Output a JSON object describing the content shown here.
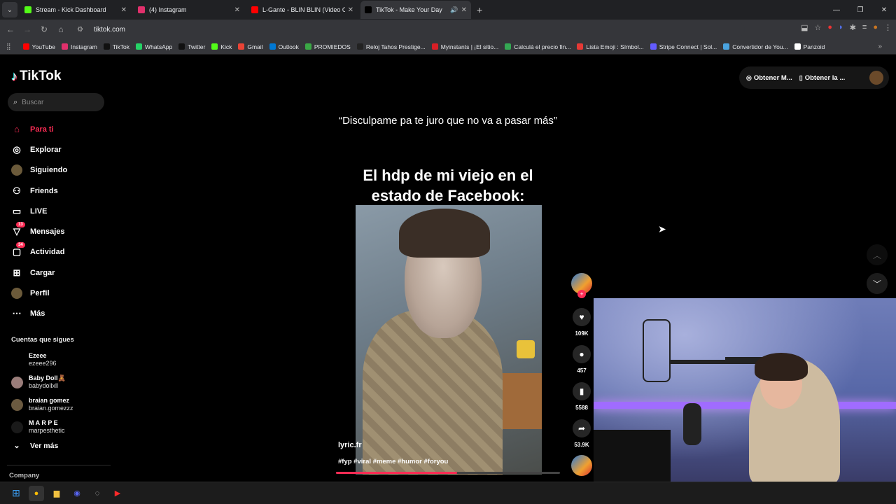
{
  "browser": {
    "tabs": [
      {
        "title": "Stream - Kick Dashboard",
        "color": "#53fc18",
        "active": false
      },
      {
        "title": "(4) Instagram",
        "color": "#e1306c",
        "active": false
      },
      {
        "title": "L-Gante - BLIN BLIN (Video Ofi...",
        "color": "#ff0000",
        "active": false
      },
      {
        "title": "TikTok - Make Your Day",
        "color": "#000000",
        "active": true
      }
    ],
    "url": "tiktok.com",
    "bookmarks": [
      {
        "label": "YouTube",
        "color": "#ff0000"
      },
      {
        "label": "Instagram",
        "color": "#e1306c"
      },
      {
        "label": "TikTok",
        "color": "#111111"
      },
      {
        "label": "WhatsApp",
        "color": "#25d366"
      },
      {
        "label": "Twitter",
        "color": "#111111"
      },
      {
        "label": "Kick",
        "color": "#53fc18"
      },
      {
        "label": "Gmail",
        "color": "#ea4335"
      },
      {
        "label": "Outlook",
        "color": "#0078d4"
      },
      {
        "label": "PROMIEDOS",
        "color": "#3aa845"
      },
      {
        "label": "Reloj Tahos Prestige...",
        "color": "#222222"
      },
      {
        "label": "Myinstants | ¡El sitio...",
        "color": "#d81f26"
      },
      {
        "label": "Calculá el precio fin...",
        "color": "#34a853"
      },
      {
        "label": "Lista Emoji : Símbol...",
        "color": "#e53935"
      },
      {
        "label": "Stripe Connect | Sol...",
        "color": "#635bff"
      },
      {
        "label": "Convertidor de You...",
        "color": "#4aa3df"
      },
      {
        "label": "Panzoid",
        "color": "#ffffff"
      }
    ]
  },
  "tiktok": {
    "logo": "TikTok",
    "search_placeholder": "Buscar",
    "nav": [
      {
        "label": "Para ti",
        "icon": "home-icon",
        "glyph": "⌂",
        "badge": ""
      },
      {
        "label": "Explorar",
        "icon": "compass-icon",
        "glyph": "◎",
        "badge": ""
      },
      {
        "label": "Siguiendo",
        "icon": "following-avatar-icon",
        "glyph": "",
        "badge": ""
      },
      {
        "label": "Friends",
        "icon": "friends-icon",
        "glyph": "⚇",
        "badge": ""
      },
      {
        "label": "LIVE",
        "icon": "live-icon",
        "glyph": "▭",
        "badge": ""
      },
      {
        "label": "Mensajes",
        "icon": "messages-icon",
        "glyph": "▽",
        "badge": "13"
      },
      {
        "label": "Actividad",
        "icon": "activity-icon",
        "glyph": "▢",
        "badge": "34"
      },
      {
        "label": "Cargar",
        "icon": "upload-icon",
        "glyph": "⊞",
        "badge": ""
      },
      {
        "label": "Perfil",
        "icon": "profile-icon",
        "glyph": "",
        "badge": ""
      },
      {
        "label": "Más",
        "icon": "more-icon",
        "glyph": "⋯",
        "badge": ""
      }
    ],
    "following_heading": "Cuentas que sigues",
    "following": [
      {
        "name": "Ezeee",
        "handle": "ezeee296",
        "color": "#000000"
      },
      {
        "name": "Baby Doll🧸",
        "handle": "babydollxll",
        "color": "#9a7d7a"
      },
      {
        "name": "braian gomez",
        "handle": "braian.gomezzz",
        "color": "#6b5a40"
      },
      {
        "name": "M A R P E",
        "handle": "marpesthetic",
        "color": "#1a1a1a"
      }
    ],
    "see_more": "Ver más",
    "company": "Company",
    "top_buttons": [
      "Obtener M...",
      "Obtener la ..."
    ],
    "video": {
      "quote": "“Disculpame pa te juro que no va a pasar más”",
      "caption": "El hdp de mi viejo en el estado de Facebook:",
      "author": "lyric.fr",
      "hashtags": "#fyp #viral #meme #humor #foryou",
      "progress": 0.54
    },
    "actions": [
      {
        "name": "like",
        "icon": "heart-icon",
        "glyph": "♥",
        "count": "109K"
      },
      {
        "name": "comment",
        "icon": "comment-icon",
        "glyph": "●",
        "count": "457"
      },
      {
        "name": "save",
        "icon": "bookmark-icon",
        "glyph": "▮",
        "count": "5588"
      },
      {
        "name": "share",
        "icon": "share-icon",
        "glyph": "➦",
        "count": "53.9K"
      }
    ]
  }
}
